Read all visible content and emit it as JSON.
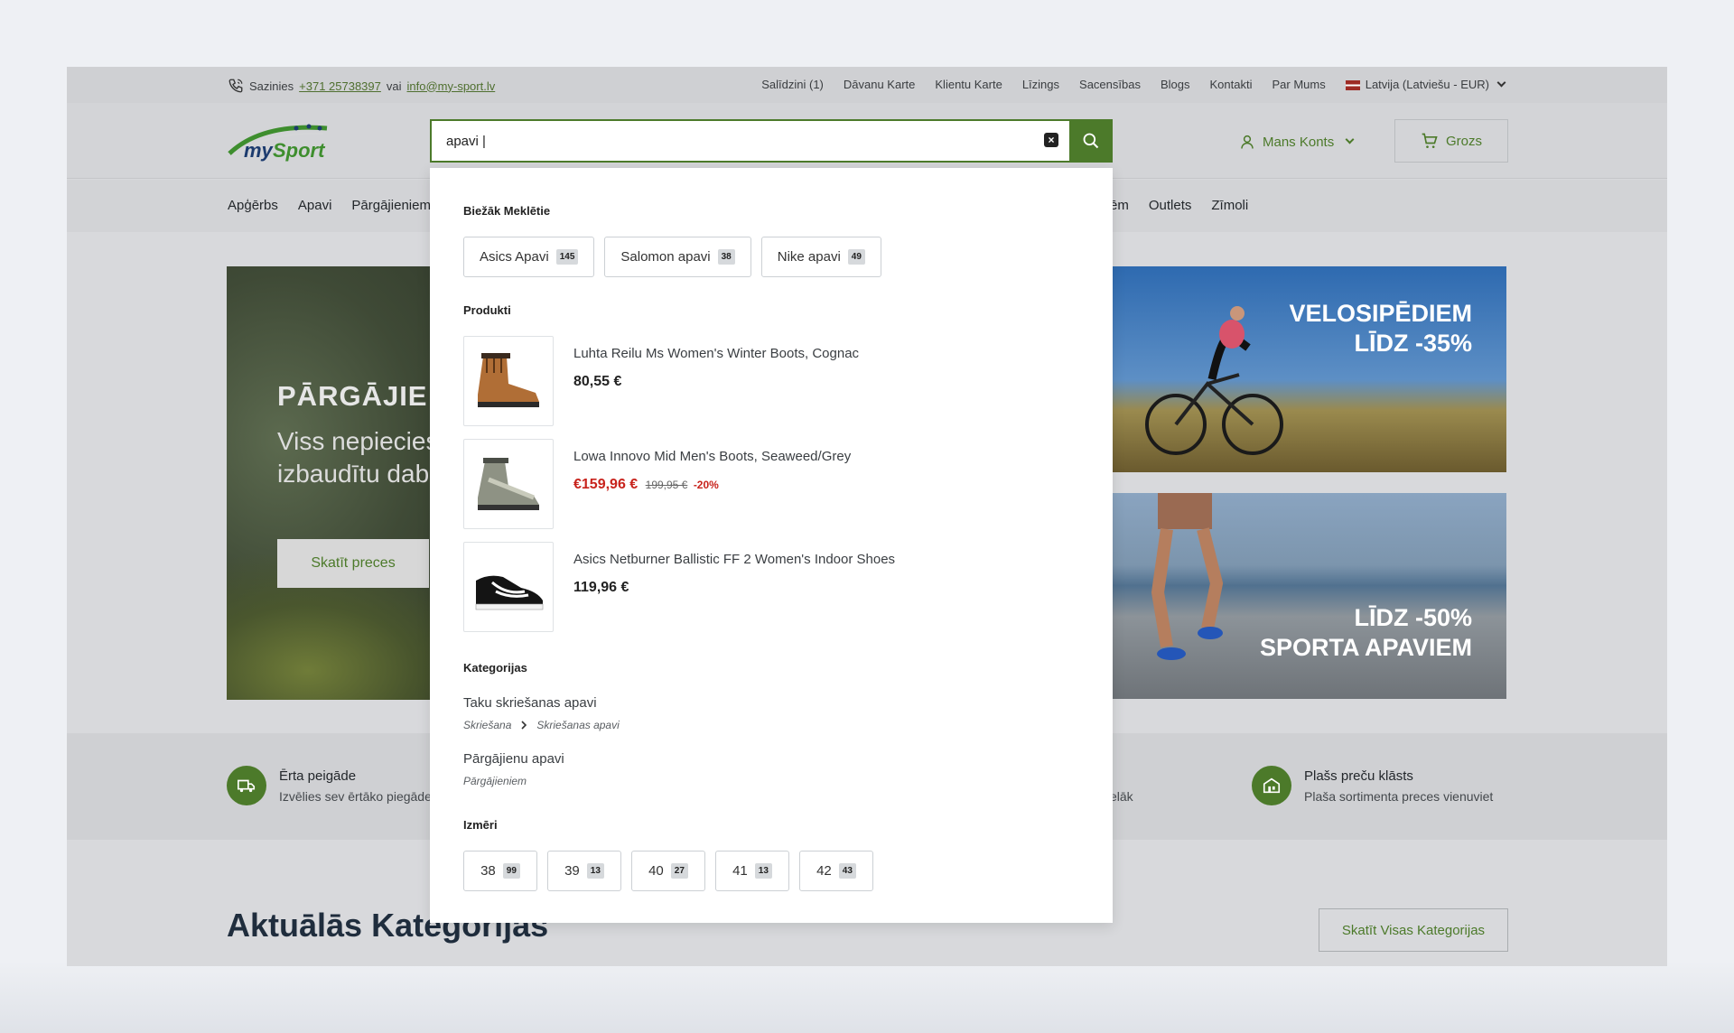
{
  "topbar": {
    "call_label": "Sazinies",
    "phone": "+371 25738397",
    "or_label": "vai",
    "email": "info@my-sport.lv",
    "links": [
      "Salīdzini (1)",
      "Dāvanu Karte",
      "Klientu Karte",
      "Līzings",
      "Sacensības",
      "Blogs",
      "Kontakti",
      "Par Mums"
    ],
    "locale": "Latvija (Latviešu - EUR)"
  },
  "header": {
    "logo_text": "mySport",
    "search_value": "apavi |",
    "account_label": "Mans Konts",
    "cart_label": "Grozs"
  },
  "nav": {
    "left": [
      "Apģērbs",
      "Apavi",
      "Pārgājieniem"
    ],
    "right_partial": "ēm",
    "right": [
      "Outlets",
      "Zīmoli"
    ]
  },
  "hero": {
    "title": "PĀRGĀJIE",
    "subtitle_line1": "Viss nepiecies",
    "subtitle_line2": "izbaudītu dab",
    "button": "Skatīt preces"
  },
  "promos": [
    {
      "line1": "VELOSIPĒDIEM",
      "line2": "LĪDZ -35%"
    },
    {
      "line1": "LĪDZ -50%",
      "line2": "SPORTA APAVIEM"
    }
  ],
  "features": [
    {
      "title": "Ērta peigāde",
      "text": "Izvēlies sev ērtāko piegāde"
    },
    {
      "title": "Plašs preču klāsts",
      "text": "Plaša sortimenta preces vienuviet"
    }
  ],
  "feature_tail": "elāk",
  "section": {
    "title": "Aktuālās Kategorijas",
    "button": "Skatīt Visas Kategorijas"
  },
  "dropdown": {
    "popular_heading": "Biežāk Meklētie",
    "popular": [
      {
        "label": "Asics Apavi",
        "count": "145"
      },
      {
        "label": "Salomon apavi",
        "count": "38"
      },
      {
        "label": "Nike apavi",
        "count": "49"
      }
    ],
    "products_heading": "Produkti",
    "products": [
      {
        "name": "Luhta Reilu Ms Women's Winter Boots, Cognac",
        "price": "80,55 €"
      },
      {
        "name": "Lowa Innovo Mid Men's Boots, Seaweed/Grey",
        "sale_price": "€159,96 €",
        "old_price": "199,95 €",
        "discount": "-20%"
      },
      {
        "name": "Asics Netburner Ballistic FF 2 Women's Indoor Shoes",
        "price": "119,96 €"
      }
    ],
    "categories_heading": "Kategorijas",
    "categories": [
      {
        "name": "Taku skriešanas apavi",
        "path": [
          "Skriešana",
          "Skriešanas apavi"
        ]
      },
      {
        "name": "Pārgājienu apavi",
        "path": [
          "Pārgājieniem"
        ]
      }
    ],
    "sizes_heading": "Izmēri",
    "sizes": [
      {
        "size": "38",
        "count": "99"
      },
      {
        "size": "39",
        "count": "13"
      },
      {
        "size": "40",
        "count": "27"
      },
      {
        "size": "41",
        "count": "13"
      },
      {
        "size": "42",
        "count": "43"
      }
    ]
  },
  "colors": {
    "brand_green": "#4c7a2a",
    "sale_red": "#c8231c"
  }
}
